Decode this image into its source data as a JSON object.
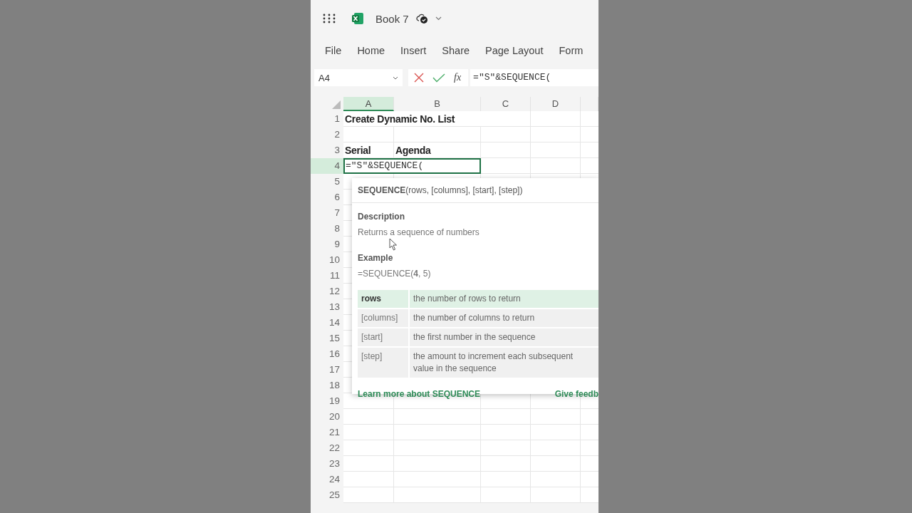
{
  "app_bar": {
    "title": "Book 7"
  },
  "menu": [
    "File",
    "Home",
    "Insert",
    "Share",
    "Page Layout",
    "Form"
  ],
  "formula_bar": {
    "name_box": "A4",
    "function_label": "fx",
    "formula": "=\"S\"&SEQUENCE("
  },
  "sheet": {
    "columns": [
      {
        "label": "A",
        "selected": true
      },
      {
        "label": "B",
        "selected": false
      },
      {
        "label": "C",
        "selected": false
      },
      {
        "label": "D",
        "selected": false
      }
    ],
    "rows": [
      {
        "label": "1",
        "selected": false,
        "column_a": "Create Dynamic No. List"
      },
      {
        "label": "2",
        "selected": false
      },
      {
        "label": "3",
        "selected": false,
        "column_a": "Serial",
        "column_b": "Agenda"
      },
      {
        "label": "4",
        "selected": true,
        "editing": "=\"S\"&SEQUENCE("
      },
      {
        "label": "5",
        "selected": false
      },
      {
        "label": "6",
        "selected": false
      },
      {
        "label": "7",
        "selected": false
      },
      {
        "label": "8",
        "selected": false
      },
      {
        "label": "9",
        "selected": false
      },
      {
        "label": "10",
        "selected": false
      },
      {
        "label": "11",
        "selected": false
      },
      {
        "label": "12",
        "selected": false
      },
      {
        "label": "13",
        "selected": false
      },
      {
        "label": "14",
        "selected": false
      },
      {
        "label": "15",
        "selected": false
      },
      {
        "label": "16",
        "selected": false
      },
      {
        "label": "17",
        "selected": false
      },
      {
        "label": "18",
        "selected": false
      },
      {
        "label": "19",
        "selected": false
      },
      {
        "label": "20",
        "selected": false
      },
      {
        "label": "21",
        "selected": false
      },
      {
        "label": "22",
        "selected": false
      },
      {
        "label": "23",
        "selected": false
      },
      {
        "label": "24",
        "selected": false
      },
      {
        "label": "25",
        "selected": false
      }
    ]
  },
  "tooltip": {
    "signature": "**SEQUENCE**(rows, [columns], [start], [step])",
    "description_heading": "Description",
    "description": "Returns a sequence of numbers",
    "example_heading": "Example",
    "example": "=SEQUENCE(**4**, 5)",
    "arguments": [
      {
        "name": "rows",
        "text": "the number of rows to return",
        "selected": true
      },
      {
        "name": "[columns]",
        "text": "the number of columns to return",
        "selected": false
      },
      {
        "name": "[start]",
        "text": "the first number in the sequence",
        "selected": false
      },
      {
        "name": "[step]",
        "text": "the amount to increment each subsequent value in the sequence",
        "selected": false
      }
    ],
    "learn_more": "Learn more about SEQUENCE",
    "feedback": "Give feedb"
  }
}
